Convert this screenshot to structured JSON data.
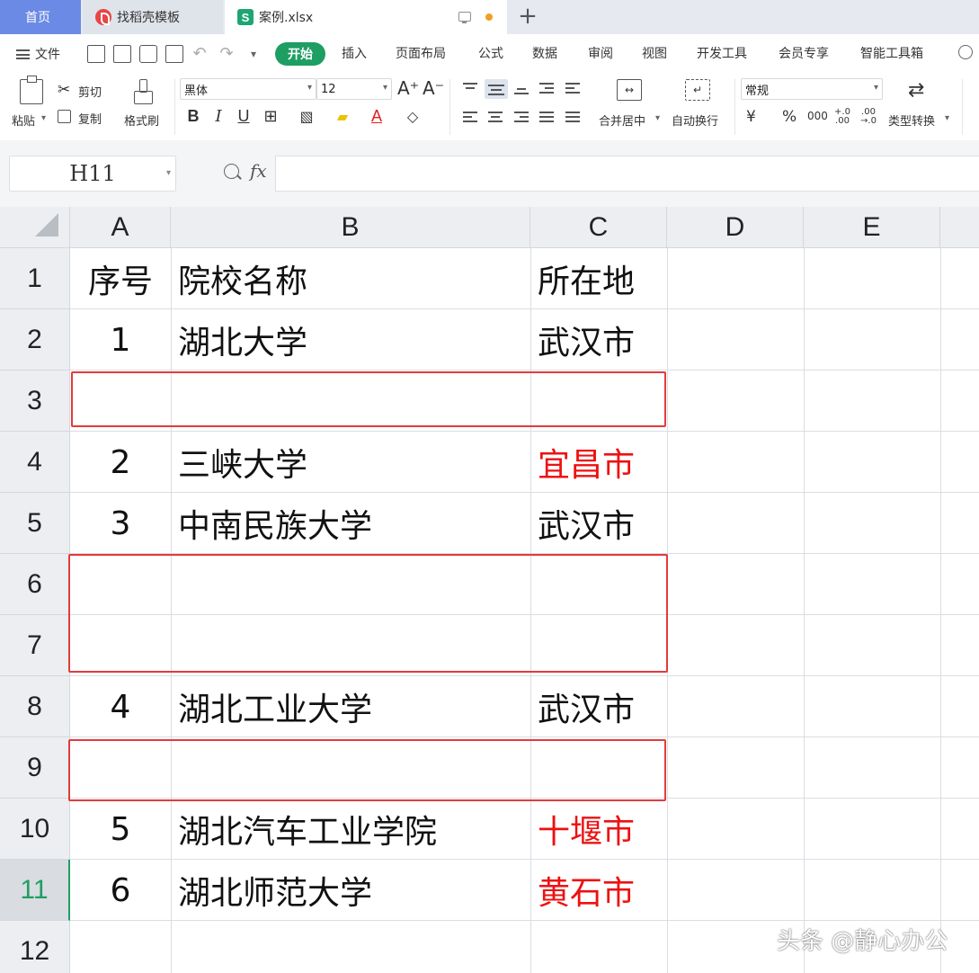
{
  "tabs": {
    "home": "首页",
    "template": "找稻壳模板",
    "document": "案例.xlsx"
  },
  "menu": {
    "file": "文件",
    "items": [
      "开始",
      "插入",
      "页面布局",
      "公式",
      "数据",
      "审阅",
      "视图",
      "开发工具",
      "会员专享",
      "智能工具箱"
    ]
  },
  "ribbon": {
    "paste": "粘贴",
    "cut": "剪切",
    "copy": "复制",
    "format_painter": "格式刷",
    "font_name": "黑体",
    "font_size": "12",
    "merge_center": "合并居中",
    "wrap_text": "自动换行",
    "number_format": "常规",
    "type_convert": "类型转换",
    "currency": "¥",
    "percent": "%",
    "thousands": "000",
    "dec_inc": "+.0 .00",
    "dec_dec": ".00 →.0",
    "font_grow": "A⁺",
    "font_shrink": "A⁻",
    "bold": "B",
    "italic": "I",
    "underline": "U"
  },
  "formula_bar": {
    "name_box": "H11",
    "fx": "fx",
    "formula": ""
  },
  "sheet": {
    "columns": [
      "A",
      "B",
      "C",
      "D",
      "E"
    ],
    "rows": [
      "1",
      "2",
      "3",
      "4",
      "5",
      "6",
      "7",
      "8",
      "9",
      "10",
      "11",
      "12"
    ],
    "active_row": "11",
    "active_cell": "H11",
    "cells": [
      {
        "a": "序号",
        "b": "院校名称",
        "c": "所在地",
        "c_color": "#111111"
      },
      {
        "a": "1",
        "b": "湖北大学",
        "c": "武汉市",
        "c_color": "#111111"
      },
      {
        "a": "",
        "b": "",
        "c": "",
        "c_color": "#111111"
      },
      {
        "a": "2",
        "b": "三峡大学",
        "c": "宜昌市",
        "c_color": "#ee1111"
      },
      {
        "a": "3",
        "b": "中南民族大学",
        "c": "武汉市",
        "c_color": "#111111"
      },
      {
        "a": "",
        "b": "",
        "c": "",
        "c_color": "#111111"
      },
      {
        "a": "",
        "b": "",
        "c": "",
        "c_color": "#111111"
      },
      {
        "a": "4",
        "b": "湖北工业大学",
        "c": "武汉市",
        "c_color": "#111111"
      },
      {
        "a": "",
        "b": "",
        "c": "",
        "c_color": "#111111"
      },
      {
        "a": "5",
        "b": "湖北汽车工业学院",
        "c": "十堰市",
        "c_color": "#ee1111"
      },
      {
        "a": "6",
        "b": "湖北师范大学",
        "c": "黄石市",
        "c_color": "#ee1111"
      },
      {
        "a": "",
        "b": "",
        "c": "",
        "c_color": "#111111"
      }
    ],
    "highlighted_blank_rows": [
      "3",
      "6-7",
      "9"
    ]
  },
  "watermark": "头条 @静心办公",
  "colors": {
    "accent_green": "#1e9e62",
    "home_tab": "#6b8ae6",
    "highlight_red": "#e23b3b",
    "text_red": "#ee1111"
  }
}
